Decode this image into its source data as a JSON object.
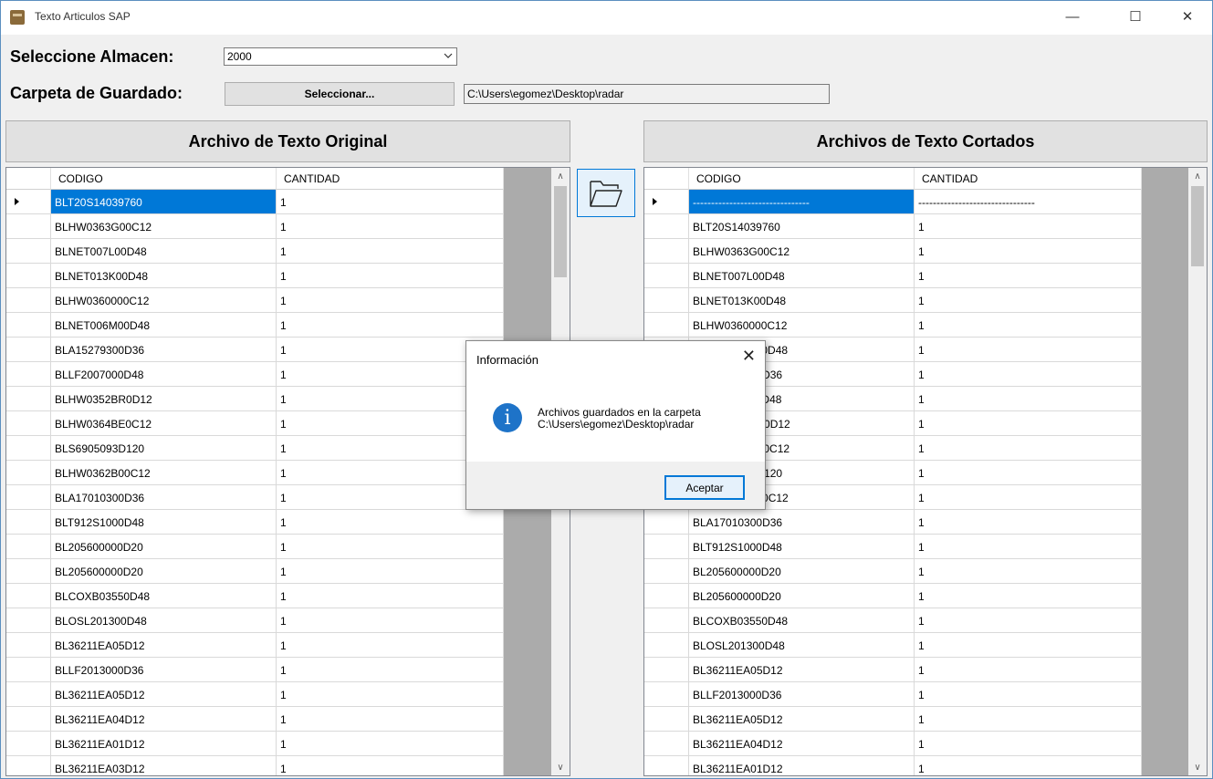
{
  "window": {
    "title": "Texto Articulos SAP",
    "min": "—",
    "max": "☐",
    "close": "✕"
  },
  "form": {
    "almacen_label": "Seleccione Almacen:",
    "almacen_value": "2000",
    "carpeta_label": "Carpeta de Guardado:",
    "select_button": "Seleccionar...",
    "path_value": "C:\\Users\\egomez\\Desktop\\radar"
  },
  "left_panel": {
    "header": "Archivo de Texto Original",
    "columns": [
      "CODIGO",
      "CANTIDAD"
    ],
    "rows": [
      [
        "BLT20S14039760",
        "1"
      ],
      [
        "BLHW0363G00C12",
        "1"
      ],
      [
        "BLNET007L00D48",
        "1"
      ],
      [
        "BLNET013K00D48",
        "1"
      ],
      [
        "BLHW0360000C12",
        "1"
      ],
      [
        "BLNET006M00D48",
        "1"
      ],
      [
        "BLA15279300D36",
        "1"
      ],
      [
        "BLLF2007000D48",
        "1"
      ],
      [
        "BLHW0352BR0D12",
        "1"
      ],
      [
        "BLHW0364BE0C12",
        "1"
      ],
      [
        "BLS6905093D120",
        "1"
      ],
      [
        "BLHW0362B00C12",
        "1"
      ],
      [
        "BLA17010300D36",
        "1"
      ],
      [
        "BLT912S1000D48",
        "1"
      ],
      [
        "BL205600000D20",
        "1"
      ],
      [
        "BL205600000D20",
        "1"
      ],
      [
        "BLCOXB03550D48",
        "1"
      ],
      [
        "BLOSL201300D48",
        "1"
      ],
      [
        "BL36211EA05D12",
        "1"
      ],
      [
        "BLLF2013000D36",
        "1"
      ],
      [
        "BL36211EA05D12",
        "1"
      ],
      [
        "BL36211EA04D12",
        "1"
      ],
      [
        "BL36211EA01D12",
        "1"
      ],
      [
        "BL36211EA03D12",
        "1"
      ]
    ]
  },
  "right_panel": {
    "header": "Archivos de Texto Cortados",
    "columns": [
      "CODIGO",
      "CANTIDAD"
    ],
    "rows": [
      [
        "--------------------------------",
        "--------------------------------"
      ],
      [
        "BLT20S14039760",
        "1"
      ],
      [
        "BLHW0363G00C12",
        "1"
      ],
      [
        "BLNET007L00D48",
        "1"
      ],
      [
        "BLNET013K00D48",
        "1"
      ],
      [
        "BLHW0360000C12",
        "1"
      ],
      [
        "BLNET006M00D48",
        "1"
      ],
      [
        "BLA15279300D36",
        "1"
      ],
      [
        "BLLF2007000D48",
        "1"
      ],
      [
        "BLHW0352BR0D12",
        "1"
      ],
      [
        "BLHW0364BE0C12",
        "1"
      ],
      [
        "BLS6905093D120",
        "1"
      ],
      [
        "BLHW0362B00C12",
        "1"
      ],
      [
        "BLA17010300D36",
        "1"
      ],
      [
        "BLT912S1000D48",
        "1"
      ],
      [
        "BL205600000D20",
        "1"
      ],
      [
        "BL205600000D20",
        "1"
      ],
      [
        "BLCOXB03550D48",
        "1"
      ],
      [
        "BLOSL201300D48",
        "1"
      ],
      [
        "BL36211EA05D12",
        "1"
      ],
      [
        "BLLF2013000D36",
        "1"
      ],
      [
        "BL36211EA05D12",
        "1"
      ],
      [
        "BL36211EA04D12",
        "1"
      ],
      [
        "BL36211EA01D12",
        "1"
      ]
    ]
  },
  "dialog": {
    "title": "Información",
    "close": "✕",
    "icon_char": "i",
    "message_line1": "Archivos guardados en la carpeta",
    "message_line2": "C:\\Users\\egomez\\Desktop\\radar",
    "ok_button": "Aceptar"
  },
  "icons": {
    "folder": "folder-open-icon",
    "info": "info-icon",
    "app": "app-icon"
  }
}
